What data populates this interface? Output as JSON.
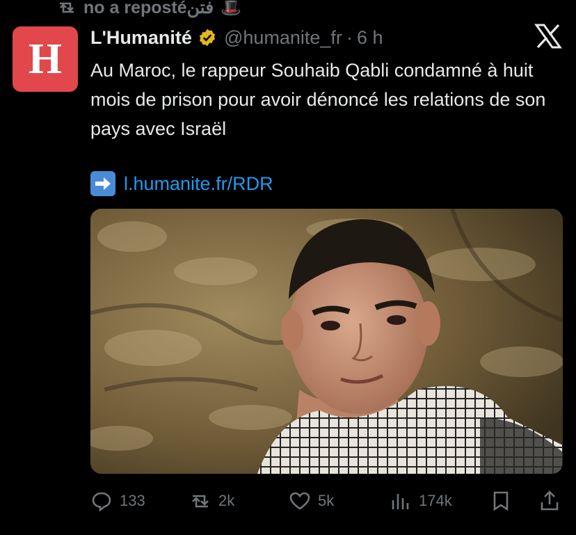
{
  "repost": {
    "text": "no a reposté",
    "user_emoji": "فتن"
  },
  "author": {
    "avatar_letter": "H",
    "name": "L'Humanité",
    "handle": "@humanite_fr",
    "separator": "·",
    "time": "6 h",
    "verified": true,
    "avatar_color": "#e1474b",
    "badge_color": "#e2b719"
  },
  "tweet": {
    "text": "Au Maroc, le rappeur Souhaib Qabli condamné à huit mois de prison pour avoir dénoncé les relations de son pays avec Israël",
    "link_emoji_icon": "right-arrow-icon",
    "link": "l.humanite.fr/RDR"
  },
  "actions": {
    "replies": "133",
    "reposts": "2k",
    "likes": "5k",
    "views": "174k"
  },
  "colors": {
    "link": "#1d9bf0",
    "muted": "#71767b",
    "text": "#e7e9ea",
    "background": "#000000"
  }
}
